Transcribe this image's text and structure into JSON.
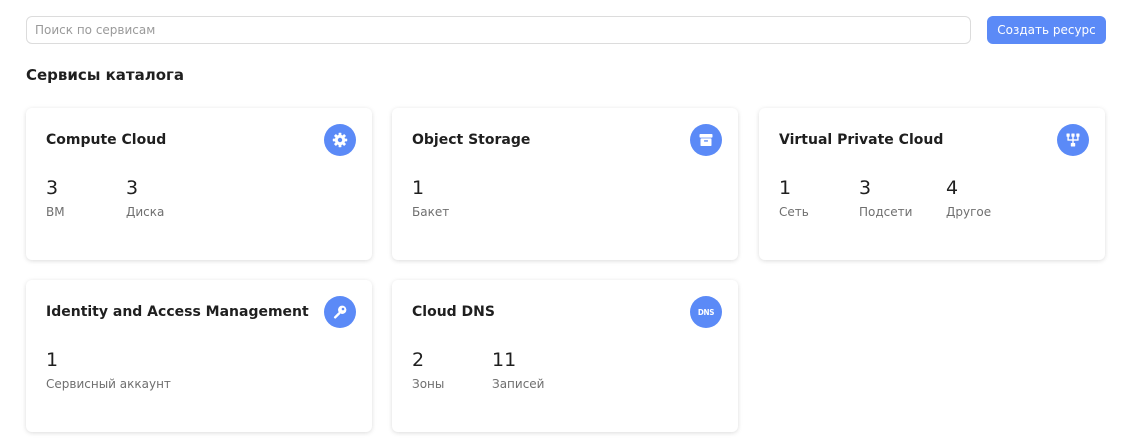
{
  "search": {
    "placeholder": "Поиск по сервисам",
    "value": ""
  },
  "create_button": {
    "label": "Создать ресурс",
    "color": "#5b8af7"
  },
  "section_title": "Сервисы каталога",
  "colors": {
    "accent": "#5b8af7",
    "label": "#6f6f6f"
  },
  "cards": [
    {
      "title": "Compute Cloud",
      "icon": "gear-icon",
      "stats": [
        {
          "value": "3",
          "label": "ВМ"
        },
        {
          "value": "3",
          "label": "Диска"
        }
      ]
    },
    {
      "title": "Object Storage",
      "icon": "storage-box-icon",
      "stats": [
        {
          "value": "1",
          "label": "Бакет"
        }
      ]
    },
    {
      "title": "Virtual Private Cloud",
      "icon": "network-icon",
      "stats": [
        {
          "value": "1",
          "label": "Сеть"
        },
        {
          "value": "3",
          "label": "Подсети"
        },
        {
          "value": "4",
          "label": "Другое"
        }
      ]
    },
    {
      "title": "Identity and Access Management",
      "icon": "key-icon",
      "stats": [
        {
          "value": "1",
          "label": "Сервисный аккаунт"
        }
      ]
    },
    {
      "title": "Cloud DNS",
      "icon": "dns-icon",
      "icon_text": "DNS",
      "stats": [
        {
          "value": "2",
          "label": "Зоны"
        },
        {
          "value": "11",
          "label": "Записей"
        }
      ]
    }
  ]
}
